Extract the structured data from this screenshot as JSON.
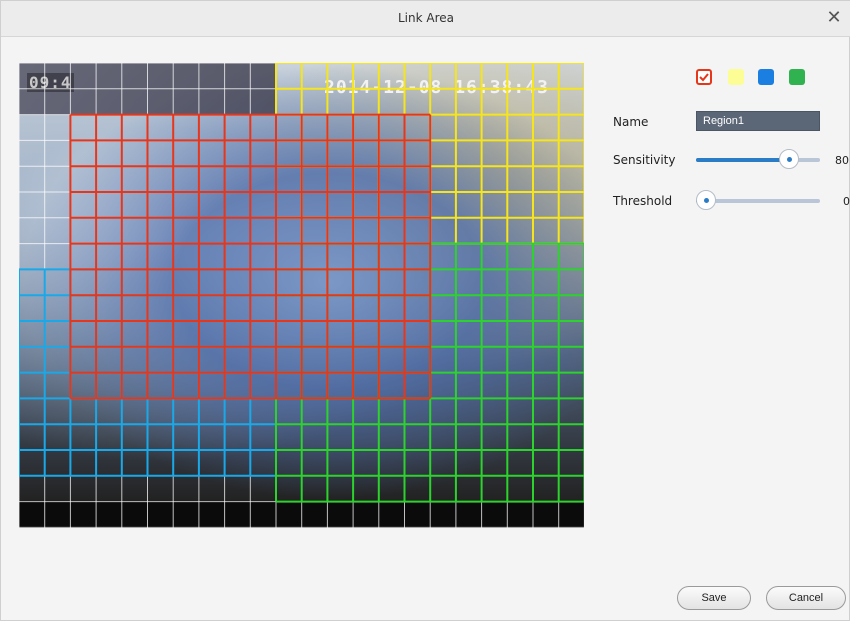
{
  "dialog": {
    "title": "Link Area",
    "close_icon": "close-icon"
  },
  "video": {
    "osd_left": "09:4",
    "timestamp": "2014-12-08 16:38:43"
  },
  "regions": {
    "colors": [
      "#e8361b",
      "#f6e51a",
      "#1aa9e8",
      "#2cd32c"
    ],
    "selected_index": 0,
    "swatch_fill": [
      "#ffffff",
      "#fdfd96",
      "#1a7fe0",
      "#2fb24f"
    ]
  },
  "settings": {
    "name_label": "Name",
    "name_value": "Region1",
    "sensitivity_label": "Sensitivity",
    "sensitivity_value": "80",
    "sensitivity_fraction": 0.8,
    "threshold_label": "Threshold",
    "threshold_value": "0",
    "threshold_fraction": 0
  },
  "buttons": {
    "save": "Save",
    "cancel": "Cancel"
  }
}
